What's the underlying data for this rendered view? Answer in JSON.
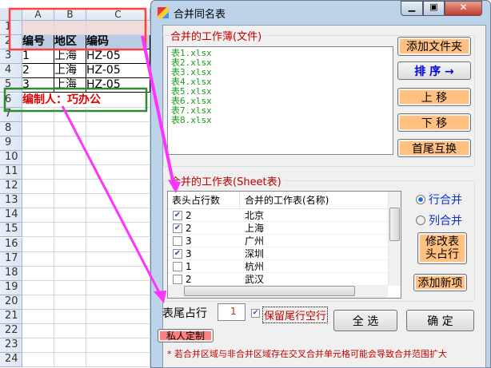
{
  "sheet": {
    "columns": [
      "A",
      "B",
      "C"
    ],
    "rows": [
      "1",
      "2",
      "3",
      "4",
      "5",
      "6",
      "7",
      "8",
      "9",
      "10",
      "11",
      "12",
      "13",
      "14",
      "15",
      "16",
      "17",
      "18",
      "19",
      "20",
      "21",
      "22",
      "23",
      "24"
    ],
    "header": [
      "编号",
      "地区",
      "编码"
    ],
    "data": [
      [
        "1",
        "上海",
        "HZ-05"
      ],
      [
        "2",
        "上海",
        "HZ-05"
      ],
      [
        "3",
        "上海",
        "HZ-05"
      ]
    ],
    "footer": "编制人：巧办公"
  },
  "dialog": {
    "title": "合并同名表",
    "workbook_group": "合并的工作薄(文件)",
    "files": [
      "表1.xlsx",
      "表2.xlsx",
      "表3.xlsx",
      "表4.xlsx",
      "表5.xlsx",
      "表6.xlsx",
      "表7.xlsx",
      "表8.xlsx"
    ],
    "buttons": {
      "add_folder": "添加文件夹",
      "sort": "排 序 →",
      "up": "上 移",
      "down": "下 移",
      "swap": "首尾互换",
      "modify_header": "修改表头占行",
      "add_item": "添加新项",
      "select_all": "全 选",
      "ok": "确 定",
      "custom": "私人定制"
    },
    "sheet_group": "合并的工作表(Sheet表)",
    "list_headers": [
      "表头占行数",
      "合并的工作表(名称)"
    ],
    "sheets": [
      {
        "rows": "2",
        "name": "北京",
        "checked": true
      },
      {
        "rows": "2",
        "name": "上海",
        "checked": true
      },
      {
        "rows": "3",
        "name": "广州",
        "checked": false
      },
      {
        "rows": "3",
        "name": "深圳",
        "checked": true
      },
      {
        "rows": "1",
        "name": "杭州",
        "checked": false
      },
      {
        "rows": "2",
        "name": "武汉",
        "checked": false
      }
    ],
    "radio_row": "行合并",
    "radio_col": "列合并",
    "footer_label": "表尾占行",
    "footer_value": "1",
    "keep_blank": "保留尾行空行",
    "note": "* 若合并区域与非合并区域存在交叉合并单元格可能会导致合并范围扩大"
  }
}
